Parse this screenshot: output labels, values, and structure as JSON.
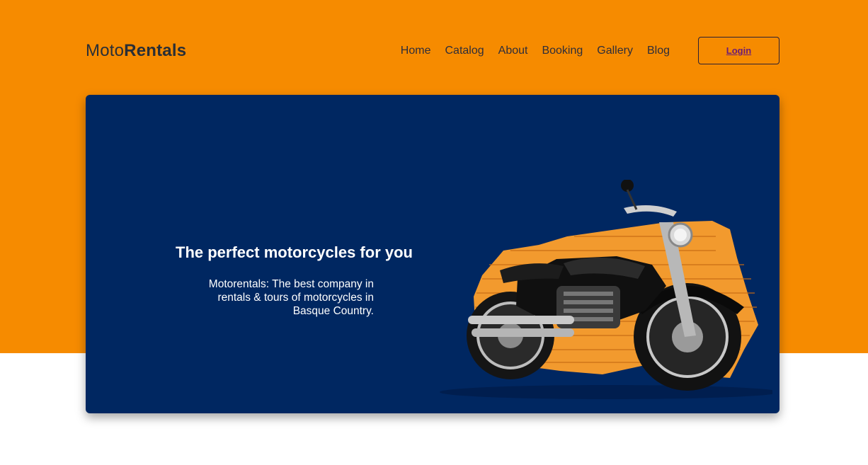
{
  "header": {
    "logo_prefix": "Moto",
    "logo_bold": "Rentals",
    "nav": [
      "Home",
      "Catalog",
      "About",
      "Booking",
      "Gallery",
      "Blog"
    ],
    "login_label": "Login"
  },
  "hero": {
    "title": "The perfect motorcycles for you",
    "description": "Motorentals: The best company in rentals & tours of motorcycles in Basque Country.",
    "image": "motorcycle-image"
  },
  "colors": {
    "band": "#f68b00",
    "hero_bg": "#002761",
    "login_text": "#6a1b78"
  }
}
